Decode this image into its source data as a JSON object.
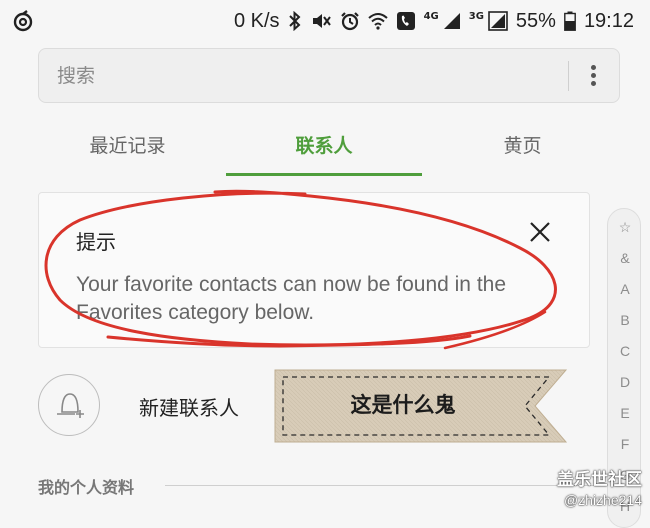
{
  "status_bar": {
    "speed": "0 K/s",
    "net_4g": "4G",
    "net_3g": "3G",
    "battery": "55%",
    "time": "19:12"
  },
  "search": {
    "placeholder": "搜索"
  },
  "tabs": [
    {
      "label": "最近记录",
      "active": false
    },
    {
      "label": "联系人",
      "active": true
    },
    {
      "label": "黄页",
      "active": false
    }
  ],
  "tip": {
    "title": "提示",
    "body": "Your favorite contacts can now be found in the Favorites category below."
  },
  "new_contact": {
    "label": "新建联系人"
  },
  "annotation": {
    "label": "这是什么鬼"
  },
  "profile": {
    "header": "我的个人资料"
  },
  "index_bar": [
    "☆",
    "&",
    "A",
    "B",
    "C",
    "D",
    "E",
    "F",
    "G",
    "H"
  ],
  "watermark": {
    "line1": "盖乐世社区",
    "line2": "@zhizhe214"
  },
  "colors": {
    "accent": "#4f9e3c",
    "annotation": "#d9342b"
  }
}
